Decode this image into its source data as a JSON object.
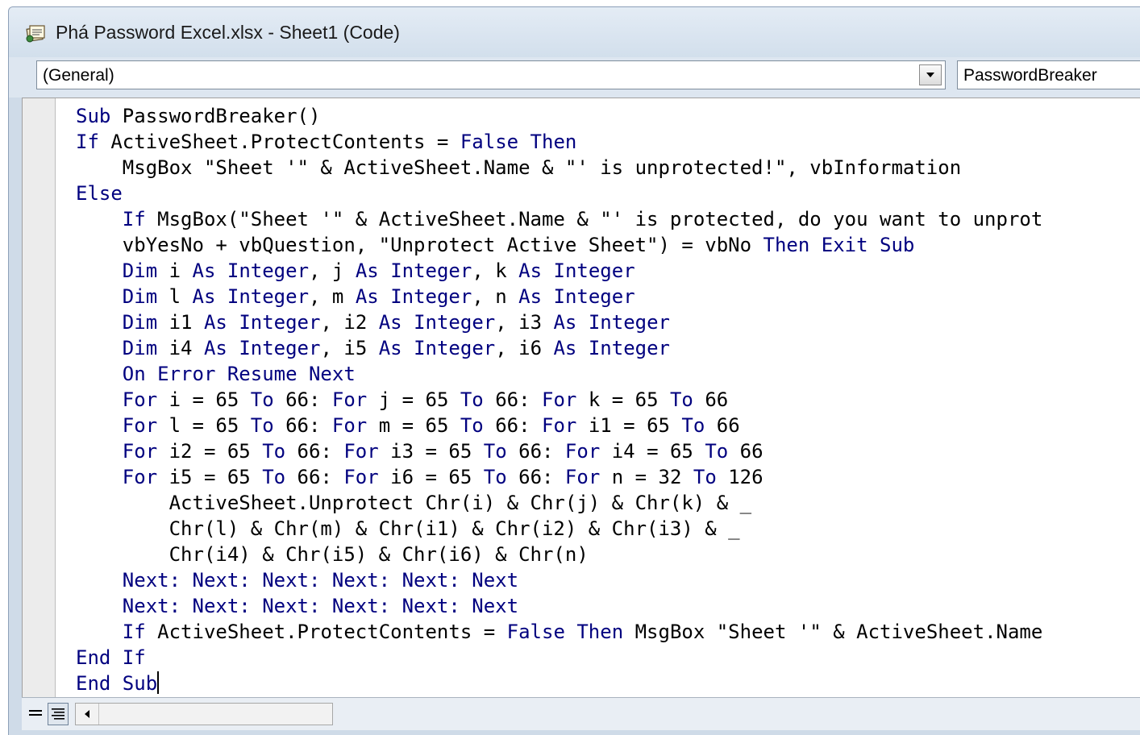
{
  "window": {
    "title": "Phá Password Excel.xlsx - Sheet1 (Code)",
    "icon": "vba-module-icon"
  },
  "object_combo": {
    "value": "(General)"
  },
  "procedure_combo": {
    "value": "PasswordBreaker"
  },
  "syntax_colors": {
    "keyword": "#00007f",
    "text": "#000000"
  },
  "code": {
    "lines": [
      [
        {
          "t": "Sub",
          "k": 1
        },
        {
          "t": " PasswordBreaker()"
        }
      ],
      [
        {
          "t": "If",
          "k": 1
        },
        {
          "t": " ActiveSheet.ProtectContents = "
        },
        {
          "t": "False",
          "k": 1
        },
        {
          "t": " "
        },
        {
          "t": "Then",
          "k": 1
        }
      ],
      [
        {
          "t": "    MsgBox \"Sheet '\" & ActiveSheet.Name & \"' is unprotected!\", vbInformation"
        }
      ],
      [
        {
          "t": "Else",
          "k": 1
        }
      ],
      [
        {
          "t": "    "
        },
        {
          "t": "If",
          "k": 1
        },
        {
          "t": " MsgBox(\"Sheet '\" & ActiveSheet.Name & \"' is protected, do you want to unprot"
        }
      ],
      [
        {
          "t": "    vbYesNo + vbQuestion, \"Unprotect Active Sheet\") = vbNo "
        },
        {
          "t": "Then",
          "k": 1
        },
        {
          "t": " "
        },
        {
          "t": "Exit",
          "k": 1
        },
        {
          "t": " "
        },
        {
          "t": "Sub",
          "k": 1
        }
      ],
      [
        {
          "t": "    "
        },
        {
          "t": "Dim",
          "k": 1
        },
        {
          "t": " i "
        },
        {
          "t": "As",
          "k": 1
        },
        {
          "t": " "
        },
        {
          "t": "Integer",
          "k": 1
        },
        {
          "t": ", j "
        },
        {
          "t": "As",
          "k": 1
        },
        {
          "t": " "
        },
        {
          "t": "Integer",
          "k": 1
        },
        {
          "t": ", k "
        },
        {
          "t": "As",
          "k": 1
        },
        {
          "t": " "
        },
        {
          "t": "Integer",
          "k": 1
        }
      ],
      [
        {
          "t": "    "
        },
        {
          "t": "Dim",
          "k": 1
        },
        {
          "t": " l "
        },
        {
          "t": "As",
          "k": 1
        },
        {
          "t": " "
        },
        {
          "t": "Integer",
          "k": 1
        },
        {
          "t": ", m "
        },
        {
          "t": "As",
          "k": 1
        },
        {
          "t": " "
        },
        {
          "t": "Integer",
          "k": 1
        },
        {
          "t": ", n "
        },
        {
          "t": "As",
          "k": 1
        },
        {
          "t": " "
        },
        {
          "t": "Integer",
          "k": 1
        }
      ],
      [
        {
          "t": "    "
        },
        {
          "t": "Dim",
          "k": 1
        },
        {
          "t": " i1 "
        },
        {
          "t": "As",
          "k": 1
        },
        {
          "t": " "
        },
        {
          "t": "Integer",
          "k": 1
        },
        {
          "t": ", i2 "
        },
        {
          "t": "As",
          "k": 1
        },
        {
          "t": " "
        },
        {
          "t": "Integer",
          "k": 1
        },
        {
          "t": ", i3 "
        },
        {
          "t": "As",
          "k": 1
        },
        {
          "t": " "
        },
        {
          "t": "Integer",
          "k": 1
        }
      ],
      [
        {
          "t": "    "
        },
        {
          "t": "Dim",
          "k": 1
        },
        {
          "t": " i4 "
        },
        {
          "t": "As",
          "k": 1
        },
        {
          "t": " "
        },
        {
          "t": "Integer",
          "k": 1
        },
        {
          "t": ", i5 "
        },
        {
          "t": "As",
          "k": 1
        },
        {
          "t": " "
        },
        {
          "t": "Integer",
          "k": 1
        },
        {
          "t": ", i6 "
        },
        {
          "t": "As",
          "k": 1
        },
        {
          "t": " "
        },
        {
          "t": "Integer",
          "k": 1
        }
      ],
      [
        {
          "t": "    "
        },
        {
          "t": "On Error Resume Next",
          "k": 1
        }
      ],
      [
        {
          "t": "    "
        },
        {
          "t": "For",
          "k": 1
        },
        {
          "t": " i = 65 "
        },
        {
          "t": "To",
          "k": 1
        },
        {
          "t": " 66: "
        },
        {
          "t": "For",
          "k": 1
        },
        {
          "t": " j = 65 "
        },
        {
          "t": "To",
          "k": 1
        },
        {
          "t": " 66: "
        },
        {
          "t": "For",
          "k": 1
        },
        {
          "t": " k = 65 "
        },
        {
          "t": "To",
          "k": 1
        },
        {
          "t": " 66"
        }
      ],
      [
        {
          "t": "    "
        },
        {
          "t": "For",
          "k": 1
        },
        {
          "t": " l = 65 "
        },
        {
          "t": "To",
          "k": 1
        },
        {
          "t": " 66: "
        },
        {
          "t": "For",
          "k": 1
        },
        {
          "t": " m = 65 "
        },
        {
          "t": "To",
          "k": 1
        },
        {
          "t": " 66: "
        },
        {
          "t": "For",
          "k": 1
        },
        {
          "t": " i1 = 65 "
        },
        {
          "t": "To",
          "k": 1
        },
        {
          "t": " 66"
        }
      ],
      [
        {
          "t": "    "
        },
        {
          "t": "For",
          "k": 1
        },
        {
          "t": " i2 = 65 "
        },
        {
          "t": "To",
          "k": 1
        },
        {
          "t": " 66: "
        },
        {
          "t": "For",
          "k": 1
        },
        {
          "t": " i3 = 65 "
        },
        {
          "t": "To",
          "k": 1
        },
        {
          "t": " 66: "
        },
        {
          "t": "For",
          "k": 1
        },
        {
          "t": " i4 = 65 "
        },
        {
          "t": "To",
          "k": 1
        },
        {
          "t": " 66"
        }
      ],
      [
        {
          "t": "    "
        },
        {
          "t": "For",
          "k": 1
        },
        {
          "t": " i5 = 65 "
        },
        {
          "t": "To",
          "k": 1
        },
        {
          "t": " 66: "
        },
        {
          "t": "For",
          "k": 1
        },
        {
          "t": " i6 = 65 "
        },
        {
          "t": "To",
          "k": 1
        },
        {
          "t": " 66: "
        },
        {
          "t": "For",
          "k": 1
        },
        {
          "t": " n = 32 "
        },
        {
          "t": "To",
          "k": 1
        },
        {
          "t": " 126"
        }
      ],
      [
        {
          "t": "        ActiveSheet.Unprotect Chr(i) & Chr(j) & Chr(k) & _"
        }
      ],
      [
        {
          "t": "        Chr(l) & Chr(m) & Chr(i1) & Chr(i2) & Chr(i3) & _"
        }
      ],
      [
        {
          "t": "        Chr(i4) & Chr(i5) & Chr(i6) & Chr(n)"
        }
      ],
      [
        {
          "t": "    "
        },
        {
          "t": "Next: Next: Next: Next: Next: Next",
          "k": 1
        }
      ],
      [
        {
          "t": "    "
        },
        {
          "t": "Next: Next: Next: Next: Next: Next",
          "k": 1
        }
      ],
      [
        {
          "t": "    "
        },
        {
          "t": "If",
          "k": 1
        },
        {
          "t": " ActiveSheet.ProtectContents = "
        },
        {
          "t": "False",
          "k": 1
        },
        {
          "t": " "
        },
        {
          "t": "Then",
          "k": 1
        },
        {
          "t": " MsgBox \"Sheet '\" & ActiveSheet.Name"
        }
      ],
      [
        {
          "t": "End If",
          "k": 1
        }
      ],
      [
        {
          "t": "End Sub",
          "k": 1
        }
      ]
    ]
  }
}
